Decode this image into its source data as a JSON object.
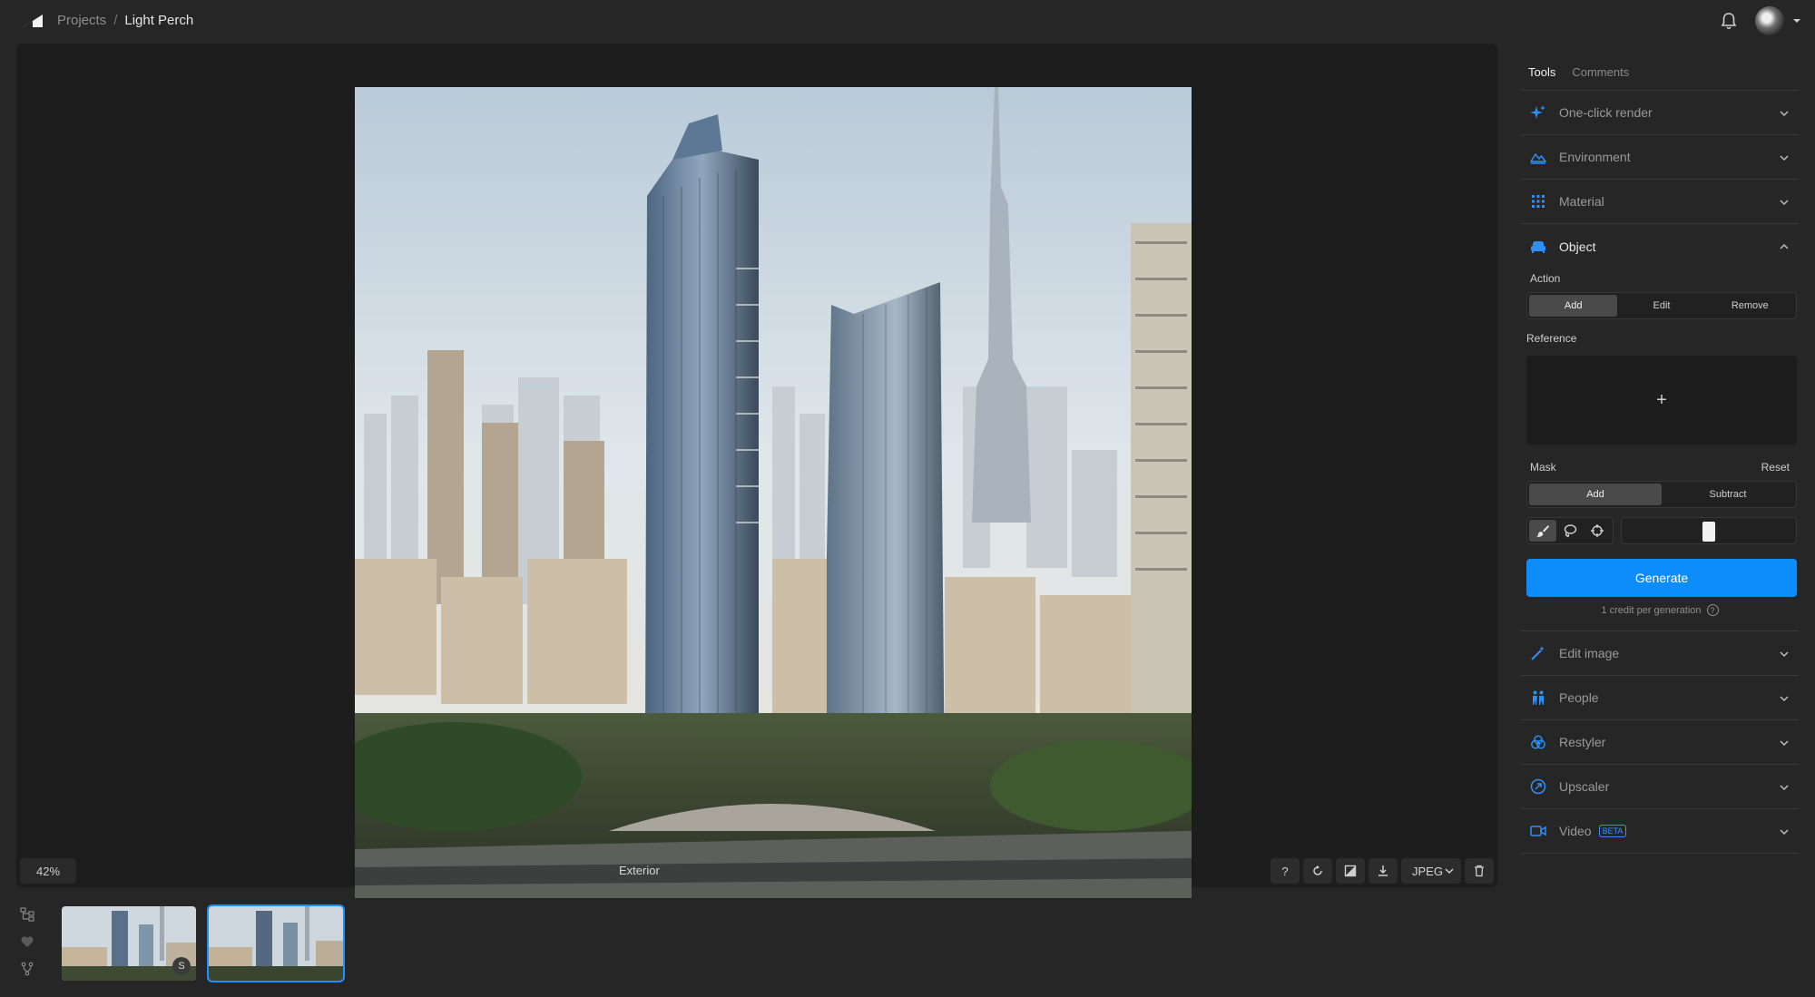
{
  "breadcrumb": {
    "root": "Projects",
    "separator": "/",
    "current": "Light Perch"
  },
  "canvas": {
    "zoom": "42%",
    "view_name": "Exterior",
    "format": "JPEG"
  },
  "thumbnails": [
    {
      "badge": "S"
    },
    {
      "badge": ""
    }
  ],
  "panel": {
    "tabs": [
      "Tools",
      "Comments"
    ],
    "sections_top": [
      {
        "label": "One-click render",
        "icon": "sparkle-icon"
      },
      {
        "label": "Environment",
        "icon": "landscape-icon"
      },
      {
        "label": "Material",
        "icon": "grid-texture-icon"
      }
    ],
    "object": {
      "label": "Object",
      "action_label": "Action",
      "actions": [
        "Add",
        "Edit",
        "Remove"
      ],
      "reference_label": "Reference",
      "reference_add": "+",
      "mask_label": "Mask",
      "mask_reset": "Reset",
      "mask_modes": [
        "Add",
        "Subtract"
      ],
      "brush_size": 0.5,
      "generate": "Generate",
      "credit_text": "1 credit per generation",
      "credit_help": "?"
    },
    "sections_bottom": [
      {
        "label": "Edit image",
        "icon": "magic-wand-icon"
      },
      {
        "label": "People",
        "icon": "people-icon"
      },
      {
        "label": "Restyler",
        "icon": "restyle-icon"
      },
      {
        "label": "Upscaler",
        "icon": "upscale-icon"
      },
      {
        "label": "Video",
        "icon": "video-camera-icon",
        "badge": "BETA"
      }
    ]
  },
  "colors": {
    "accent": "#0d8dfb",
    "background": "#262626",
    "canvas": "#1d1d1d"
  }
}
